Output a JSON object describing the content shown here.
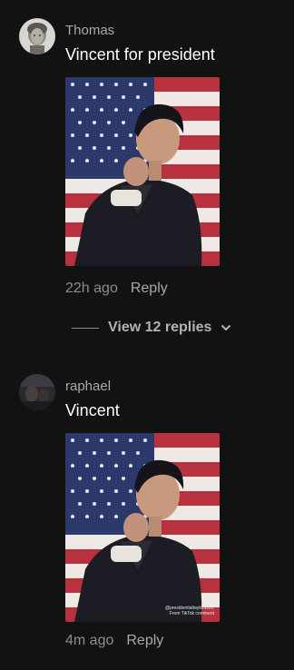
{
  "comments": [
    {
      "username": "Thomas",
      "text": "Vincent for president",
      "time": "22h ago",
      "reply_label": "Reply",
      "avatar_icon": "marble-bust-avatar"
    },
    {
      "username": "raphael",
      "text": "Vincent",
      "time": "4m ago",
      "reply_label": "Reply",
      "avatar_icon": "dark-photo-avatar",
      "watermark_handle": "@presidentialtaylorsvorr",
      "watermark_from": "From TikTok comment"
    }
  ],
  "view_replies_label": "View 12 replies",
  "colors": {
    "background": "#121212",
    "username": "#a9a9ad",
    "meta": "#8d8d92",
    "flag_red": "#b8313f",
    "flag_blue": "#2c3a6b"
  }
}
